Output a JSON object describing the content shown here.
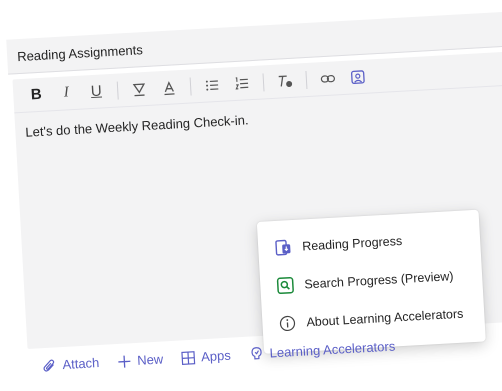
{
  "title": {
    "value": "Reading Assignments"
  },
  "toolbar": {
    "bold": "B",
    "italic": "I",
    "underline": "U"
  },
  "editor": {
    "body": "Let's do the Weekly Reading Check-in."
  },
  "popup": {
    "items": [
      {
        "label": "Reading Progress",
        "icon": "reading-progress-icon"
      },
      {
        "label": "Search Progress (Preview)",
        "icon": "search-progress-icon"
      },
      {
        "label": "About Learning Accelerators",
        "icon": "info-icon"
      }
    ]
  },
  "actions": {
    "attach": "Attach",
    "new": "New",
    "apps": "Apps",
    "learning_accelerators": "Learning Accelerators"
  },
  "colors": {
    "accent": "#5b5fc7",
    "search_icon_green": "#1b8a3a",
    "field_bg": "#f3f3f4"
  }
}
